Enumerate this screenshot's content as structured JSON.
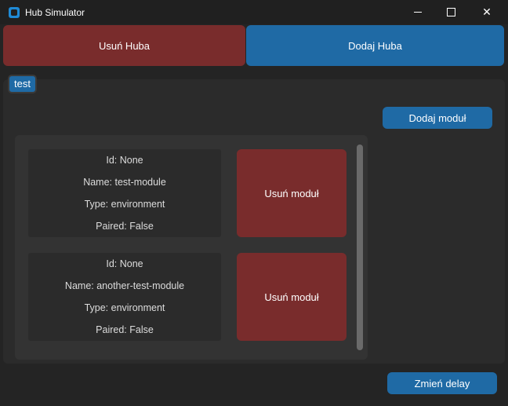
{
  "window": {
    "title": "Hub Simulator",
    "controls": {
      "minimize_icon": "minimize-icon",
      "maximize_icon": "maximize-icon",
      "close_glyph": "✕"
    }
  },
  "hub_actions": {
    "remove_label": "Usuń Huba",
    "add_label": "Dodaj Huba"
  },
  "tabs": [
    {
      "label": "test",
      "selected": true
    }
  ],
  "add_module_label": "Dodaj moduł",
  "modules": [
    {
      "id": "Id: None",
      "name": "Name: test-module",
      "type": "Type: environment",
      "paired": "Paired: False",
      "remove_label": "Usuń moduł"
    },
    {
      "id": "Id: None",
      "name": "Name: another-test-module",
      "type": "Type: environment",
      "paired": "Paired: False",
      "remove_label": "Usuń moduł"
    }
  ],
  "change_delay_label": "Zmień delay",
  "colors": {
    "accent_blue": "#1f6aa5",
    "danger_red": "#792c2c",
    "background": "#242424",
    "panel": "#2b2b2b"
  }
}
